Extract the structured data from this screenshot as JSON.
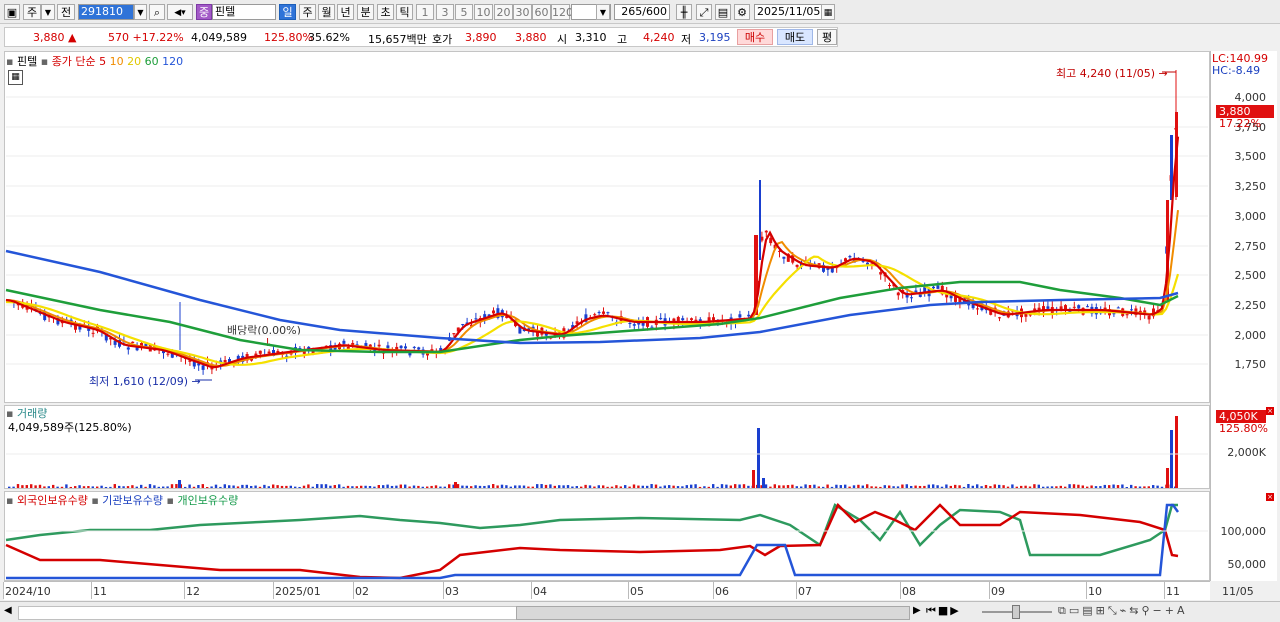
{
  "toolbar": {
    "type_label": "주",
    "prev_label": "전",
    "stock_code": "291810",
    "stock_name": "핀텔",
    "stock_tag": "중",
    "periods": [
      "일",
      "주",
      "월",
      "년",
      "분",
      "초",
      "틱"
    ],
    "minutes": [
      "1",
      "3",
      "5",
      "10",
      "20",
      "30",
      "60",
      "120"
    ],
    "count_value": "265",
    "count_total": "/600",
    "date": "2025/11/05"
  },
  "quote": {
    "price": "3,880 ▲",
    "change": "570 +17.22%",
    "volume": "4,049,589",
    "vol_ratio": "125.80%",
    "turnover": "35.62%",
    "amount": "15,657백만",
    "bid_label": "호가",
    "bid": "3,890",
    "ask": "3,880",
    "open_label": "시",
    "open": "3,310",
    "high_label": "고",
    "high": "4,240",
    "low_label": "저",
    "low": "3,195",
    "buy_btn": "매수",
    "sell_btn": "매도",
    "eval_btn": "평"
  },
  "price_panel": {
    "legend_name": "핀텔",
    "ma_title": "종가 단순",
    "ma_periods": [
      "5",
      "10",
      "20",
      "60",
      "120"
    ],
    "lc": "LC:140.99",
    "hc": "HC:-8.49",
    "max_label": "최고 4,240 (11/05)",
    "min_label": "최저 1,610 (12/09)",
    "dividend_label": "배당락(0.00%)",
    "current_price_tag": "3,880",
    "current_pct_tag": "17.22%",
    "y_ticks": [
      "4,000",
      "3,750",
      "3,500",
      "3,250",
      "3,000",
      "2,750",
      "2,500",
      "2,250",
      "2,000",
      "1,750"
    ]
  },
  "volume_panel": {
    "title": "거래량",
    "value": "4,049,589주(125.80%)",
    "tag": "4,050K",
    "tag_pct": "125.80%",
    "y_tick": "2,000K"
  },
  "holdings_panel": {
    "foreign": "외국인보유수량",
    "institution": "기관보유수량",
    "individual": "개인보유수량",
    "y_ticks": [
      "100,000",
      "50,000"
    ]
  },
  "x_axis": {
    "labels": [
      "2024/10",
      "11",
      "12",
      "2025/01",
      "02",
      "03",
      "04",
      "05",
      "06",
      "07",
      "08",
      "09",
      "10",
      "11"
    ],
    "right_label": "11/05"
  },
  "colors": {
    "ma5": "#d40000",
    "ma10": "#f08c00",
    "ma20": "#f5e000",
    "ma60": "#1e9e3a",
    "ma120": "#2455d8",
    "foreign": "#d40000",
    "institution": "#2455d8",
    "individual": "#2e9a5e"
  }
}
